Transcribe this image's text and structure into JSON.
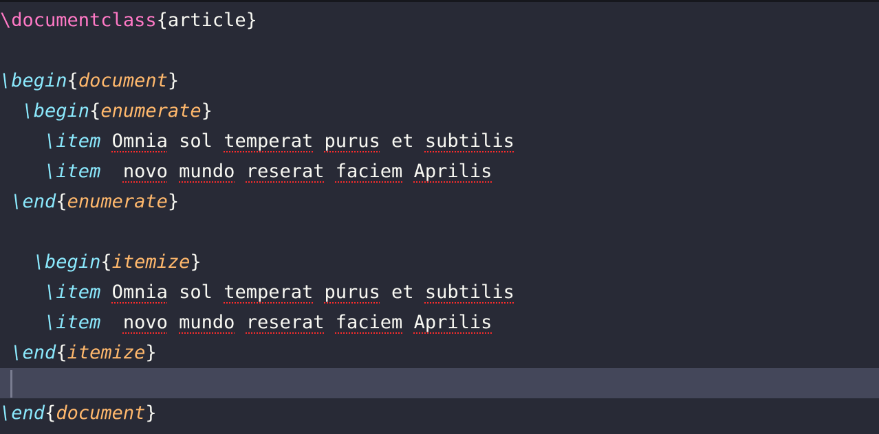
{
  "editor": {
    "lines": [
      {
        "indent": "",
        "cmd": "documentclass",
        "arg": "article",
        "style": "class"
      },
      {
        "blank": true
      },
      {
        "indent": "",
        "cmd": "begin",
        "arg": "document"
      },
      {
        "indent": "  ",
        "cmd": "begin",
        "arg": "enumerate"
      },
      {
        "indent": "    ",
        "cmd": "item",
        "words": [
          "Omnia",
          "sol",
          "temperat",
          "purus",
          "et",
          "subtilis"
        ],
        "spellcheck": [
          true,
          false,
          true,
          true,
          false,
          true
        ],
        "lead": " "
      },
      {
        "indent": "    ",
        "cmd": "item",
        "words": [
          "novo",
          "mundo",
          "reserat",
          "faciem",
          "Aprilis"
        ],
        "spellcheck": [
          true,
          true,
          true,
          true,
          true
        ],
        "lead": "  "
      },
      {
        "indent": " ",
        "cmd": "end",
        "arg": "enumerate"
      },
      {
        "blank": true
      },
      {
        "indent": "   ",
        "cmd": "begin",
        "arg": "itemize"
      },
      {
        "indent": "    ",
        "cmd": "item",
        "words": [
          "Omnia",
          "sol",
          "temperat",
          "purus",
          "et",
          "subtilis"
        ],
        "spellcheck": [
          true,
          false,
          true,
          true,
          false,
          true
        ],
        "lead": " "
      },
      {
        "indent": "    ",
        "cmd": "item",
        "words": [
          "novo",
          "mundo",
          "reserat",
          "faciem",
          "Aprilis"
        ],
        "spellcheck": [
          true,
          true,
          true,
          true,
          true
        ],
        "lead": "  "
      },
      {
        "indent": " ",
        "cmd": "end",
        "arg": "itemize"
      },
      {
        "blank": true,
        "current": true
      },
      {
        "indent": "",
        "cmd": "end",
        "arg": "document"
      }
    ]
  },
  "colors": {
    "background": "#282a36",
    "current_line": "#44475a",
    "command": "#8be9fd",
    "class_command": "#ff79c6",
    "argument": "#ffb86c",
    "text": "#f8f8f2",
    "spell_underline": "#ff2b2b"
  }
}
